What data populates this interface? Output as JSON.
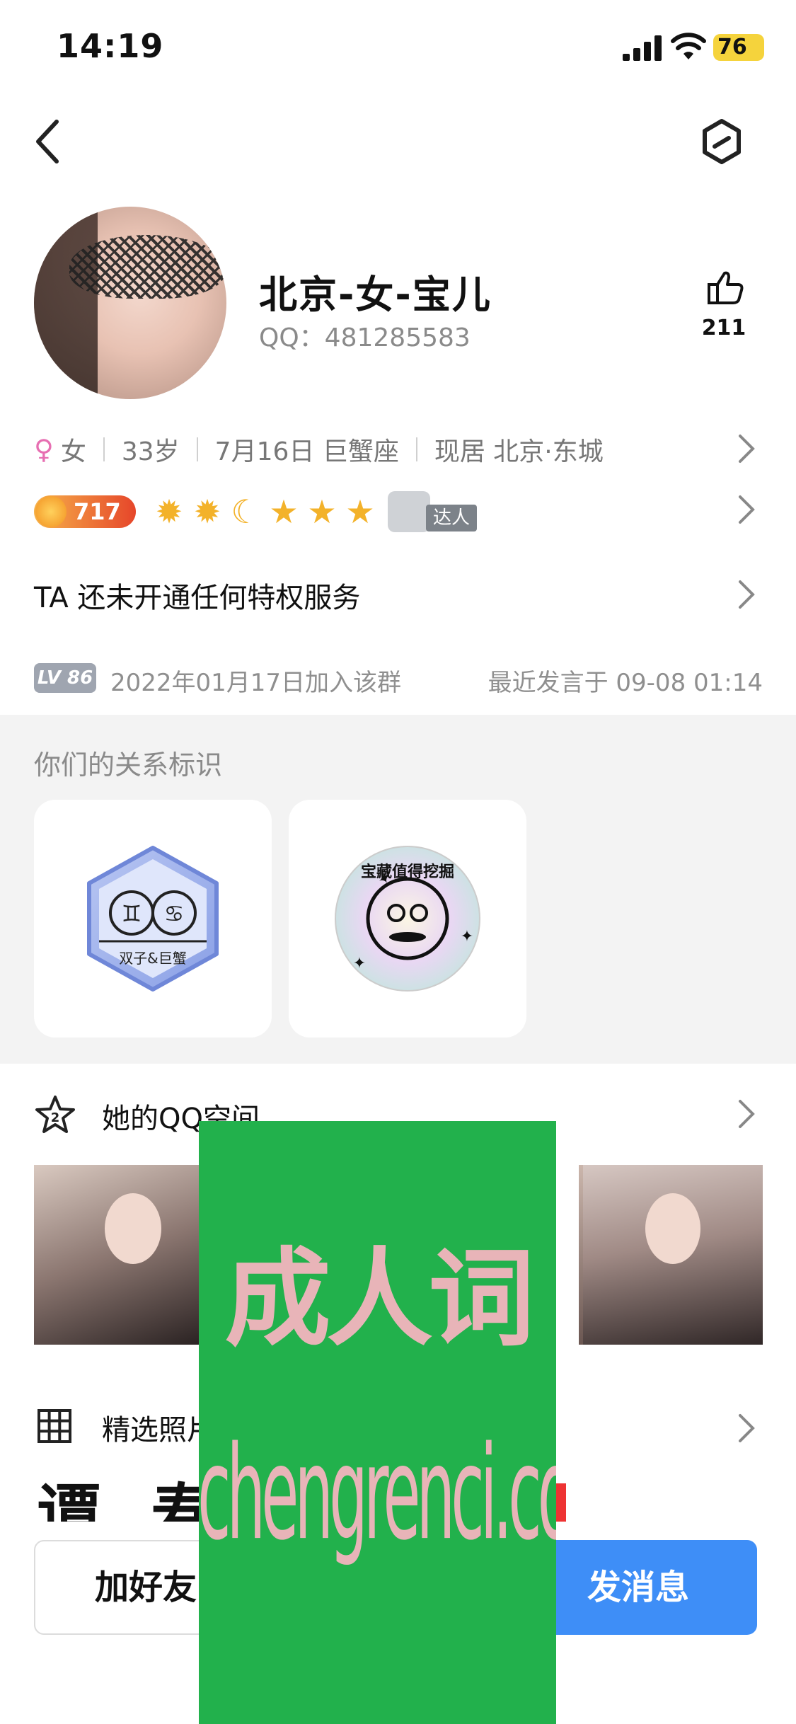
{
  "status_bar": {
    "time": "14:19",
    "battery": "76"
  },
  "profile": {
    "nickname": "北京-女-宝儿",
    "qq": "QQ：481285583",
    "like_count": "211"
  },
  "info": {
    "gender": "女",
    "age": "33岁",
    "birthday": "7月16日 巨蟹座",
    "location": "现居 北京·东城"
  },
  "level": {
    "value": "717",
    "icons": [
      "sun",
      "sun",
      "moon",
      "star",
      "star",
      "star"
    ],
    "daren": "达人"
  },
  "privilege_text": "TA 还未开通任何特权服务",
  "group": {
    "lv": "LV 86",
    "joined": "2022年01月17日加入该群",
    "last_spoke": "最近发言于 09-08 01:14"
  },
  "relation": {
    "title": "你们的关系标识",
    "cards": [
      {
        "caption": "双子&巨蟹"
      },
      {
        "caption": "宝藏值得挖掘"
      }
    ]
  },
  "qzone": {
    "label": "她的QQ空间"
  },
  "selected_photos": {
    "label": "精选照片"
  },
  "partial_text": "谭 寿",
  "buttons": {
    "add_friend": "加好友",
    "send_message": "发消息"
  },
  "watermark": {
    "cn": "成人词",
    "en": "chengrenci.com"
  },
  "colors": {
    "accent": "#3e8ef7",
    "watermark_bg": "#22b14c",
    "watermark_text": "#e8b4b8"
  }
}
